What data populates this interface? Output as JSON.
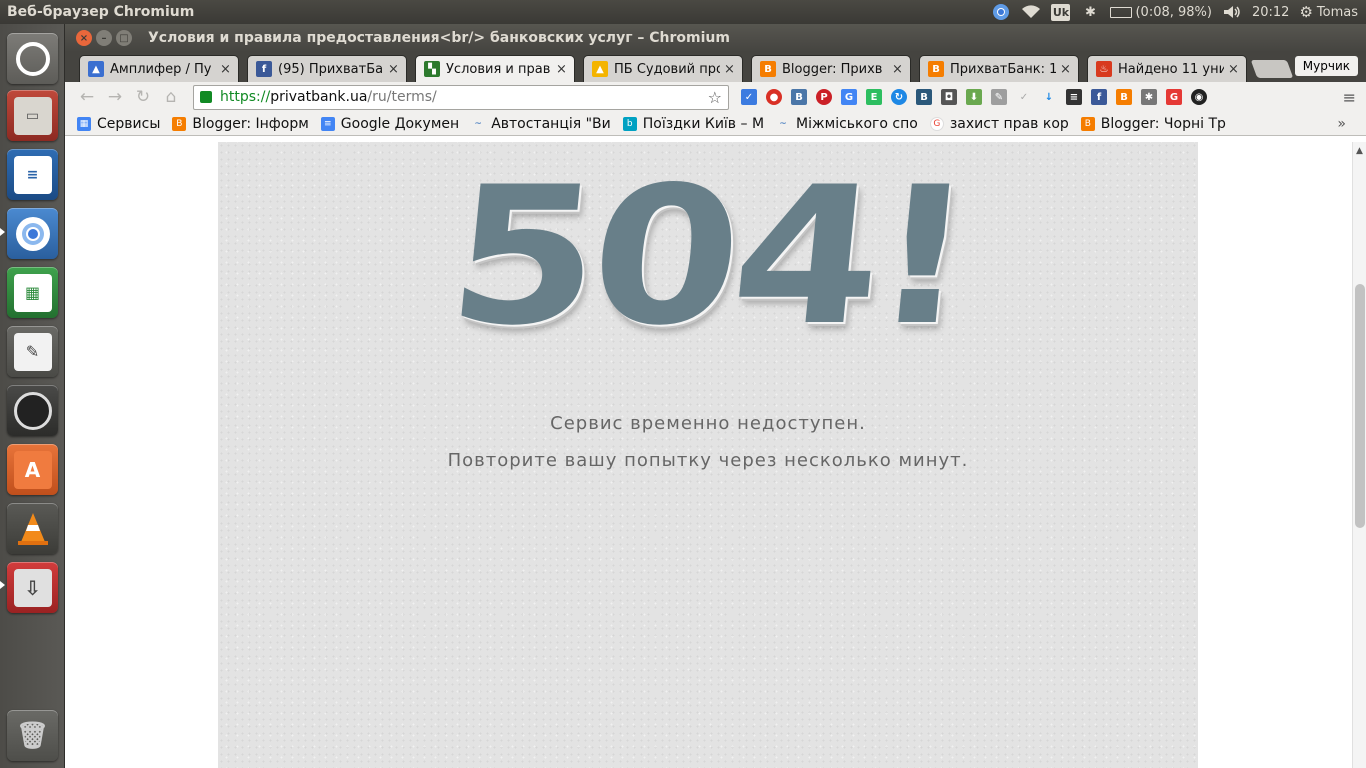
{
  "panel": {
    "app_title": "Веб-браузер Chromium",
    "battery": "(0:08, 98%)",
    "keyboard_layout": "Uk",
    "clock": "20:12",
    "user": "Tomas"
  },
  "window": {
    "title": "Условия и правила предоставления<br/> банковских услуг – Chromium"
  },
  "tabs": [
    {
      "label": "Амплифер / Пу",
      "favicon": "amplifer-icon",
      "color": "#3b6fd0"
    },
    {
      "label": "(95) ПрихватБа",
      "favicon": "facebook-icon",
      "color": "#3b5998"
    },
    {
      "label": "Условия и прав",
      "favicon": "privatbank-icon",
      "color": "#2d7a2d",
      "active": true
    },
    {
      "label": "ПБ Судовий про",
      "favicon": "google-drive-icon",
      "color": "#f4b400"
    },
    {
      "label": "Blogger: Прихв",
      "favicon": "blogger-icon",
      "color": "#f57d00"
    },
    {
      "label": "ПрихватБанк: 1",
      "favicon": "blogger-icon",
      "color": "#f57d00"
    },
    {
      "label": "Найдено 11 уни",
      "favicon": "flame-icon",
      "color": "#d83a1e"
    }
  ],
  "profile_name": "Мурчик",
  "omnibox": {
    "scheme": "https://",
    "host": "privatbank.ua",
    "path": "/ru/terms/"
  },
  "bookmarks": [
    {
      "label": "Сервисы",
      "icon": "apps-grid-icon",
      "color": "#4285f4"
    },
    {
      "label": "Blogger: Інформ",
      "icon": "blogger-icon",
      "color": "#f57d00"
    },
    {
      "label": "Google Докумен",
      "icon": "google-docs-icon",
      "color": "#4285f4"
    },
    {
      "label": "Автостанція \"Ви",
      "icon": "bus-icon",
      "color": "#1a5fb4"
    },
    {
      "label": "Поїздки Київ – М",
      "icon": "blablacar-icon",
      "color": "#00a1c2"
    },
    {
      "label": "Міжміського спо",
      "icon": "bus-icon",
      "color": "#1a5fb4"
    },
    {
      "label": "захист прав кор",
      "icon": "google-icon",
      "color": "#ea4335"
    },
    {
      "label": "Blogger: Чорні Тр",
      "icon": "blogger-icon",
      "color": "#f57d00"
    }
  ],
  "error_page": {
    "code": "504!",
    "line1": "Сервис временно недоступен.",
    "line2": "Повторите вашу попытку через несколько минут.",
    "code_color": "#687f89"
  }
}
